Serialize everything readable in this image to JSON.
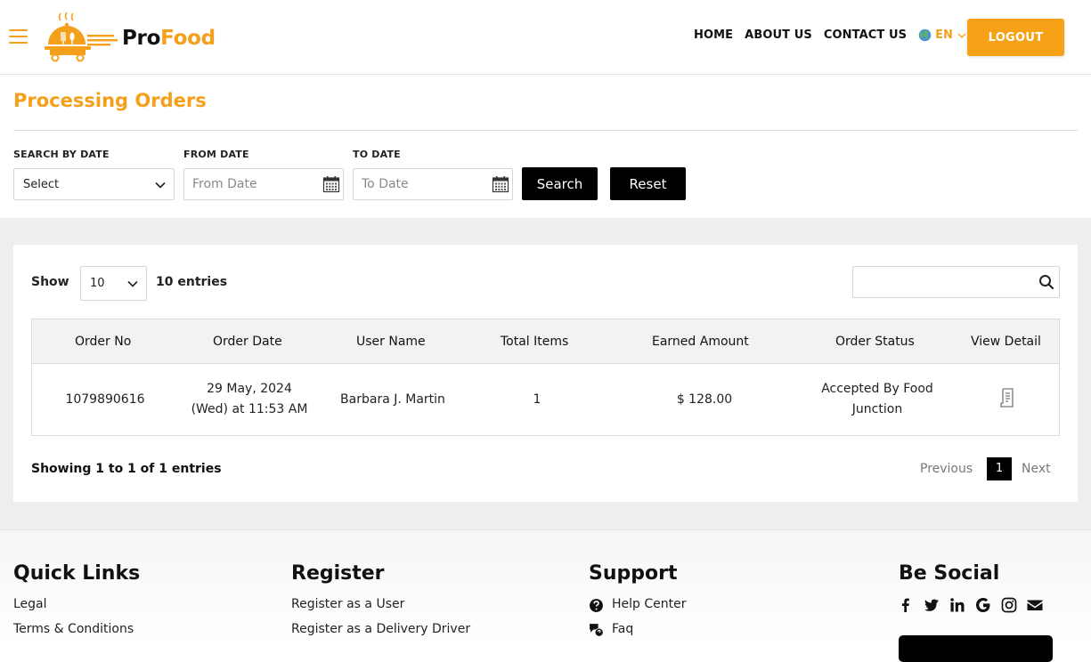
{
  "header": {
    "brand_pro": "Pro",
    "brand_food": "Food",
    "nav": [
      "HOME",
      "ABOUT US",
      "CONTACT US"
    ],
    "lang_code": "EN",
    "logout_label": "LOGOUT",
    "accent_color": "#f5a01a"
  },
  "filters": {
    "title": "Processing Orders",
    "search_by_date_label": "SEARCH BY DATE",
    "search_by_date_value": "Select",
    "from_date_label": "FROM DATE",
    "from_date_placeholder": "From Date",
    "to_date_label": "TO DATE",
    "to_date_placeholder": "To Date",
    "search_button": "Search",
    "reset_button": "Reset"
  },
  "table_controls": {
    "show_label": "Show",
    "entries_value": "10",
    "entries_label": "10 entries"
  },
  "table": {
    "columns": [
      "Order No",
      "Order Date",
      "User Name",
      "Total Items",
      "Earned Amount",
      "Order Status",
      "View Detail"
    ],
    "rows": [
      {
        "order_no": "1079890616",
        "order_date_line1": "29 May, 2024",
        "order_date_line2": "(Wed) at 11:53 AM",
        "user_name": "Barbara J. Martin",
        "total_items": "1",
        "earned_amount": "$ 128.00",
        "status_line1": "Accepted By Food",
        "status_line2": "Junction",
        "view_icon": "receipt-icon"
      }
    ]
  },
  "pagination": {
    "showing_text": "Showing 1 to 1 of 1 entries",
    "previous": "Previous",
    "current": "1",
    "next": "Next"
  },
  "footer": {
    "quick_links_title": "Quick Links",
    "quick_links": [
      "Legal",
      "Terms & Conditions"
    ],
    "register_title": "Register",
    "register_links": [
      "Register as a User",
      "Register as a Delivery Driver"
    ],
    "support_title": "Support",
    "support_links": [
      "Help Center",
      "Faq"
    ],
    "social_title": "Be Social",
    "social_icons": [
      "facebook-icon",
      "twitter-icon",
      "linkedin-icon",
      "google-icon",
      "instagram-icon",
      "envelope-icon"
    ]
  }
}
